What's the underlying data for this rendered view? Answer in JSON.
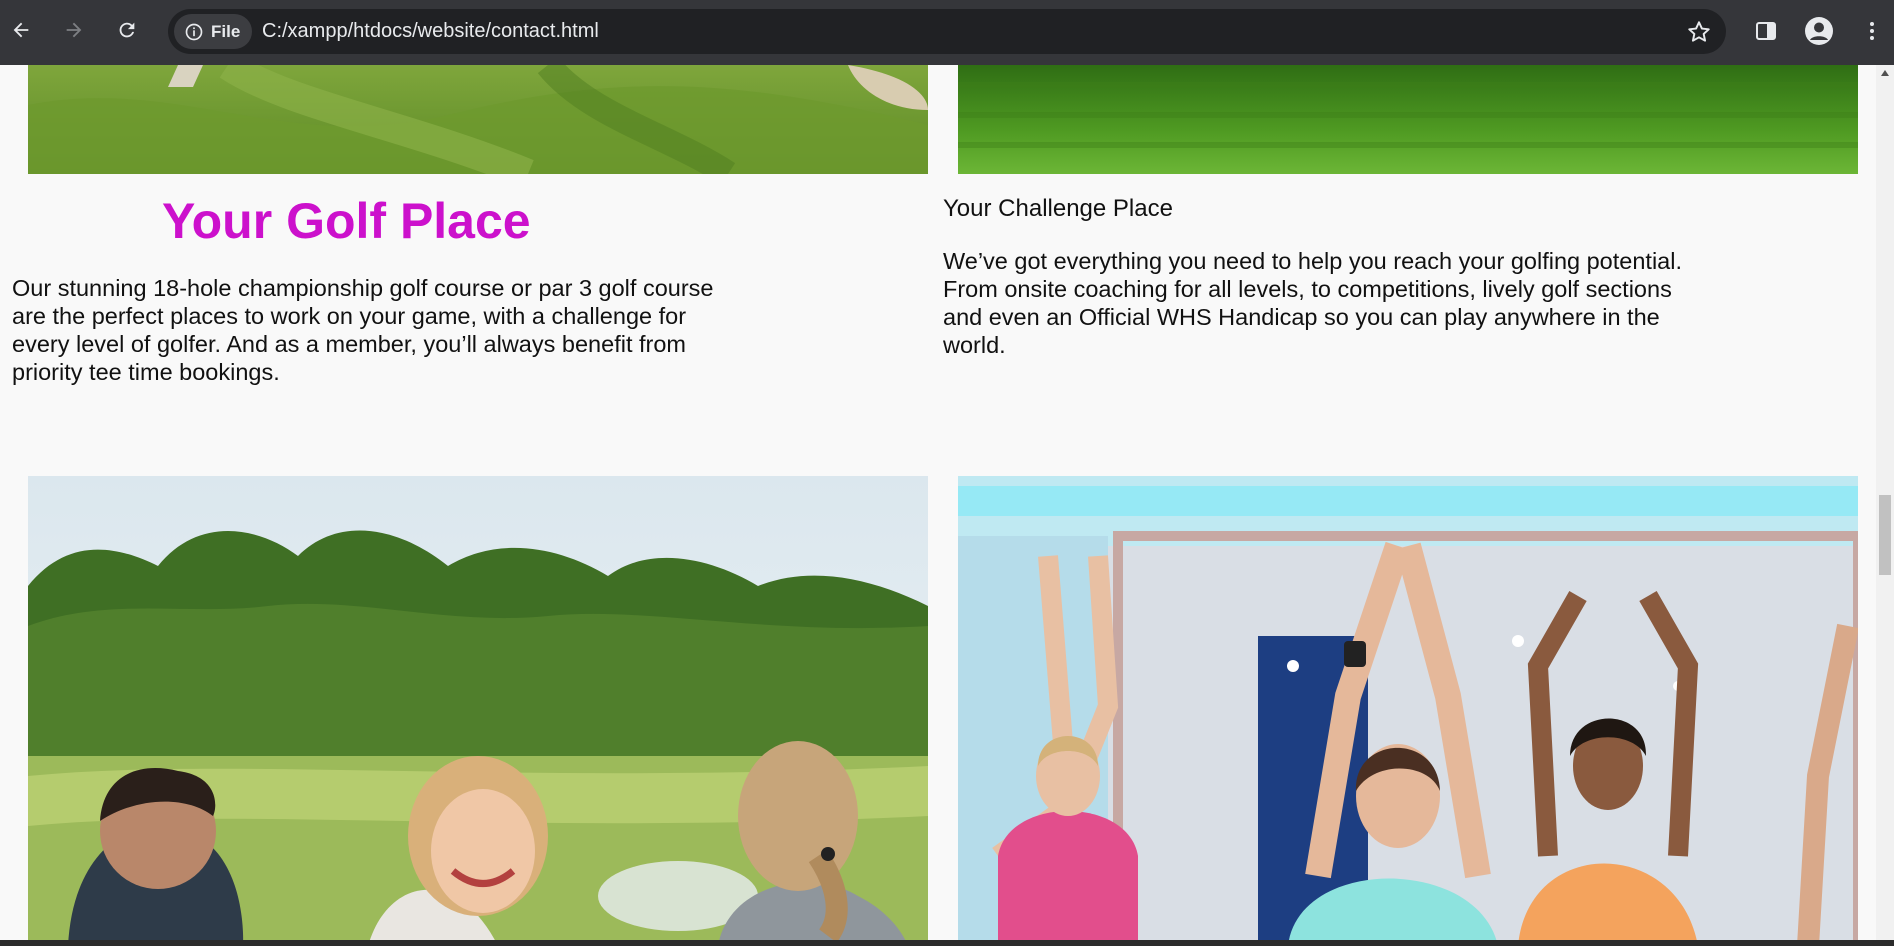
{
  "browser": {
    "site_chip_label": "File",
    "url": "C:/xampp/htdocs/website/contact.html"
  },
  "icons": {
    "back": "arrow-left-icon",
    "forward": "arrow-right-icon",
    "reload": "reload-icon",
    "site_info": "info-icon",
    "bookmark": "star-icon",
    "side_panel": "side-panel-icon",
    "profile": "profile-icon",
    "menu": "kebab-menu-icon"
  },
  "golf": {
    "title": "Your Golf Place",
    "text": "Our stunning 18-hole championship golf course or par 3 golf course are the perfect places to work on your game, with a challenge for every level of golfer. And as a member, you’ll always benefit from priority tee time bookings.",
    "title_color": "#cc11cc"
  },
  "challenge": {
    "title": "Your Challenge Place",
    "text": "We’ve got everything you need to help you reach your golfing potential. From onsite coaching for all levels, to competitions, lively golf sections and even an Official WHS Handicap so you can play anywhere in the world."
  },
  "colors": {
    "chrome_bg": "#35363a",
    "omnibox_bg": "#202124",
    "page_bg": "#f9f9f9"
  }
}
